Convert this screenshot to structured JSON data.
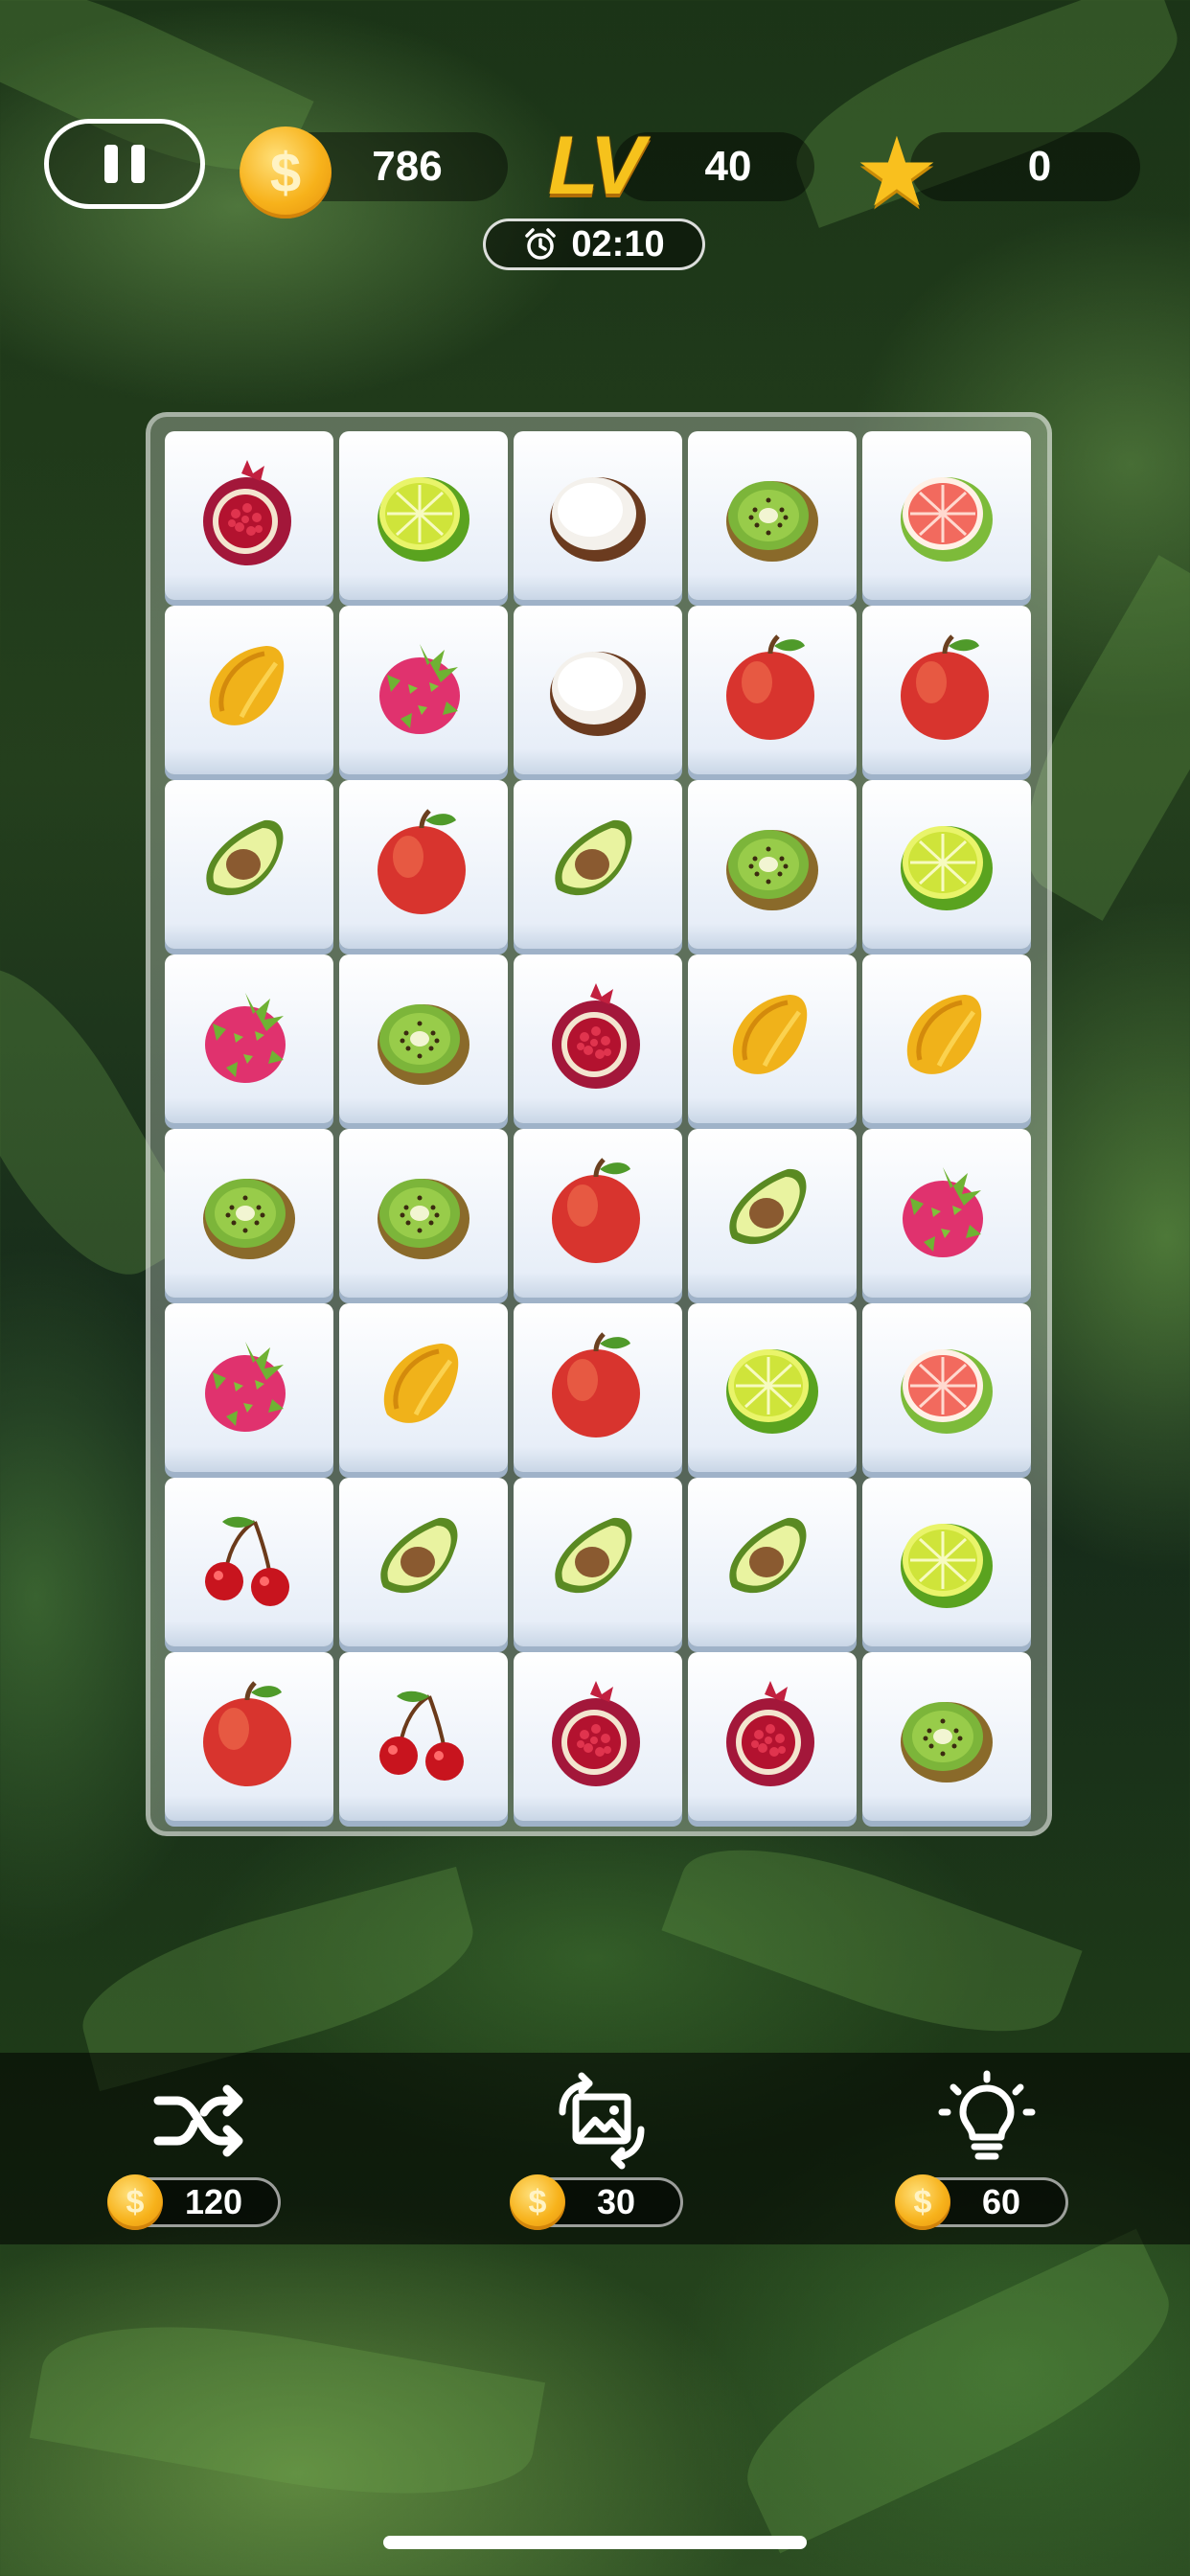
{
  "hud": {
    "coins": "786",
    "level_label": "LV",
    "level": "40",
    "stars": "0",
    "timer": "02:10",
    "coin_symbol": "$"
  },
  "board": {
    "rows": [
      [
        "pomegranate",
        "lime",
        "coconut",
        "kiwi",
        "grapefruit"
      ],
      [
        "starfruit",
        "dragonfruit",
        "coconut",
        "apple",
        "apple"
      ],
      [
        "avocado",
        "apple",
        "avocado",
        "kiwi",
        "lime"
      ],
      [
        "dragonfruit",
        "kiwi",
        "pomegranate",
        "starfruit",
        "starfruit"
      ],
      [
        "kiwi",
        "kiwi",
        "apple",
        "avocado",
        "dragonfruit"
      ],
      [
        "dragonfruit",
        "starfruit",
        "apple",
        "lime",
        "grapefruit"
      ],
      [
        "cherry",
        "avocado",
        "avocado",
        "avocado",
        "lime"
      ],
      [
        "apple",
        "cherry",
        "pomegranate",
        "pomegranate",
        "kiwi"
      ]
    ]
  },
  "tools": {
    "shuffle": {
      "cost": "120",
      "icon": "shuffle-icon"
    },
    "image": {
      "cost": "30",
      "icon": "image-swap-icon"
    },
    "hint": {
      "cost": "60",
      "icon": "lightbulb-icon"
    }
  },
  "colors": {
    "coin": "#f7b21b",
    "level_text": "#f6c21c",
    "star": "#f9c01e",
    "tile": "#e7eef8"
  }
}
